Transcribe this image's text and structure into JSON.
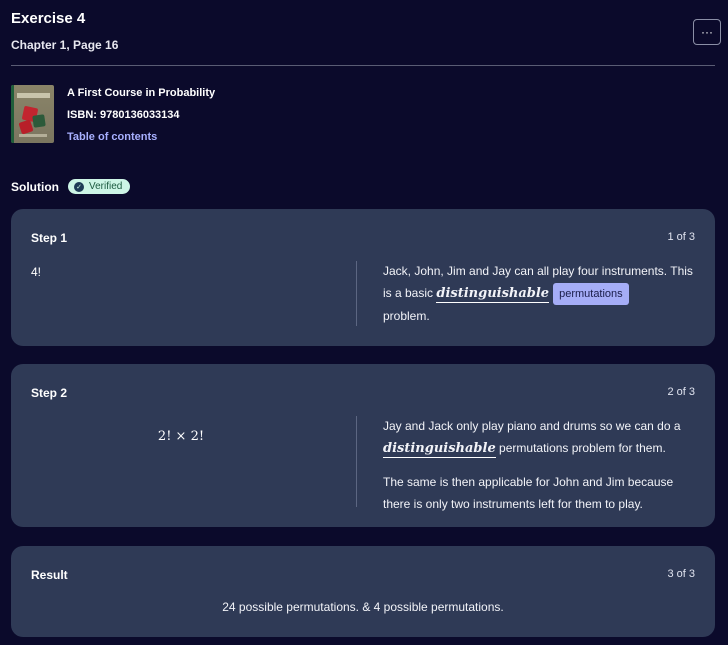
{
  "header": {
    "title": "Exercise 4",
    "subtitle": "Chapter 1, Page 16",
    "more_label": "···"
  },
  "book": {
    "title": "A First Course in Probability",
    "isbn": "ISBN: 9780136033134",
    "toc_label": "Table of contents"
  },
  "solution": {
    "label": "Solution",
    "badge": "Verified"
  },
  "steps": [
    {
      "title": "Step 1",
      "count": "1 of 3",
      "math": "4!",
      "text_a": "Jack, John, Jim and Jay can all play four instruments. This is a basic ",
      "term": "distinguishable",
      "chip": "permutations",
      "text_b": "problem."
    },
    {
      "title": "Step 2",
      "count": "2 of 3",
      "math": "2! × 2!",
      "text_a": "Jay and Jack only play piano and drums so we can do a ",
      "term": "distinguishable",
      "text_b": " permutations problem for them.",
      "para2": "The same is then applicable for John and Jim because there is only two instruments left for them to play."
    }
  ],
  "result": {
    "title": "Result",
    "count": "3 of 3",
    "text": "24 possible permutations. & 4 possible permutations."
  },
  "colors": {
    "background": "#0b0a2b",
    "card": "#2f3a56",
    "link": "#a8b0ff",
    "chip": "#a5adf7",
    "verified_bg": "#cdf5e6"
  }
}
